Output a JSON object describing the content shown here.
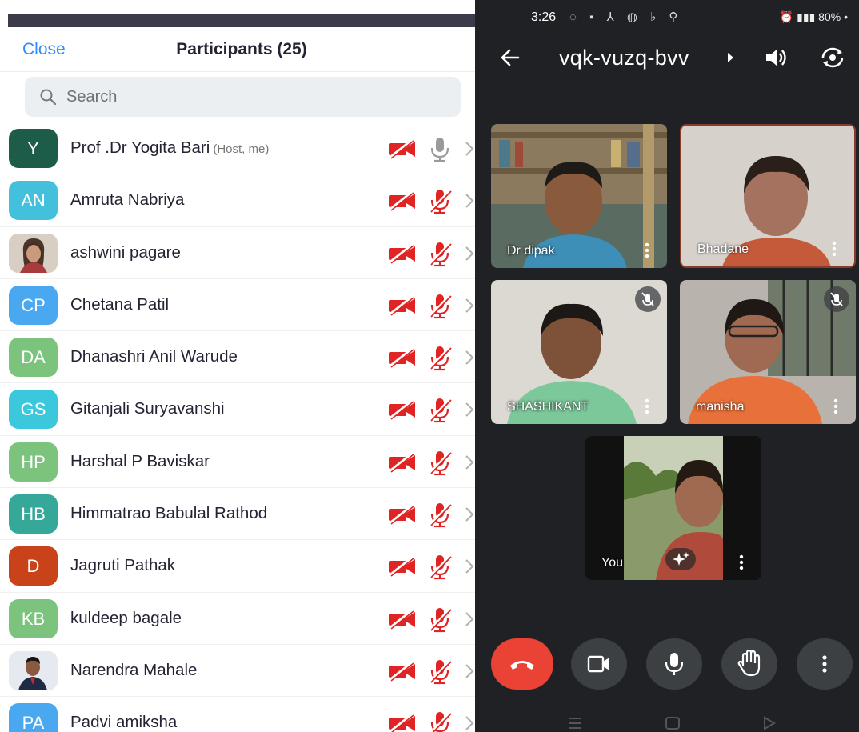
{
  "participants_panel": {
    "close_label": "Close",
    "title": "Participants (25)",
    "search_placeholder": "Search",
    "participants": [
      {
        "initials": "Y",
        "name": "Prof .Dr Yogita Bari",
        "tag": "(Host, me)",
        "avatar_color": "#1e5c4a",
        "mic_muted": false
      },
      {
        "initials": "AN",
        "name": "Amruta Nabriya",
        "tag": "",
        "avatar_color": "#43c0dc",
        "mic_muted": true
      },
      {
        "initials": "",
        "name": "ashwini pagare",
        "tag": "",
        "avatar_color": "#c8b8a8",
        "photo": "woman-photo",
        "mic_muted": true
      },
      {
        "initials": "CP",
        "name": "Chetana Patil",
        "tag": "",
        "avatar_color": "#4aa8f0",
        "mic_muted": true
      },
      {
        "initials": "DA",
        "name": "Dhanashri Anil Warude",
        "tag": "",
        "avatar_color": "#7cc47e",
        "mic_muted": true
      },
      {
        "initials": "GS",
        "name": "Gitanjali Suryavanshi",
        "tag": "",
        "avatar_color": "#3cc8dc",
        "mic_muted": true
      },
      {
        "initials": "HP",
        "name": "Harshal P Baviskar",
        "tag": "",
        "avatar_color": "#7cc47e",
        "mic_muted": true
      },
      {
        "initials": "HB",
        "name": "Himmatrao Babulal Rathod",
        "tag": "",
        "avatar_color": "#36a89a",
        "mic_muted": true
      },
      {
        "initials": "D",
        "name": "Jagruti Pathak",
        "tag": "",
        "avatar_color": "#c9421a",
        "mic_muted": true
      },
      {
        "initials": "KB",
        "name": "kuldeep bagale",
        "tag": "",
        "avatar_color": "#7cc47e",
        "mic_muted": true
      },
      {
        "initials": "",
        "name": "Narendra Mahale",
        "tag": "",
        "avatar_color": "#dfe3ea",
        "photo": "man-photo",
        "mic_muted": true
      },
      {
        "initials": "PA",
        "name": "Padvi amiksha",
        "tag": "",
        "avatar_color": "#4aa8f0",
        "mic_muted": true
      }
    ]
  },
  "meet_panel": {
    "status_bar": {
      "time": "3:26",
      "right": "80%"
    },
    "meeting_code": "vqk-vuzq-bvv",
    "tiles": [
      {
        "name": "Dr dipak",
        "muted": false,
        "bg": "#6f7f74"
      },
      {
        "name": "Bhadane",
        "muted": false,
        "bg": "#cfcac5"
      },
      {
        "name": "SHASHIKANT",
        "muted": true,
        "bg": "#d9d5d0"
      },
      {
        "name": "manisha",
        "muted": true,
        "bg": "#b9b6af"
      },
      {
        "name": "You",
        "muted": false,
        "bg": "#111"
      }
    ],
    "colors": {
      "end_call": "#ea4335",
      "control_bg": "#3c4043",
      "muted_red": "#e02424"
    }
  }
}
